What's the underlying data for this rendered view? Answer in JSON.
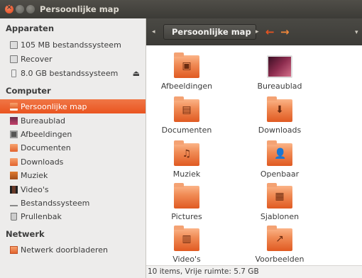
{
  "window": {
    "title": "Persoonlijke map"
  },
  "sidebar": {
    "devices_heading": "Apparaten",
    "devices": [
      {
        "label": "105 MB bestandssysteem",
        "icon": "disk-icon"
      },
      {
        "label": "Recover",
        "icon": "disk-icon"
      },
      {
        "label": "8.0 GB bestandssysteem",
        "icon": "usb-drive-icon",
        "eject": "⏏"
      }
    ],
    "computer_heading": "Computer",
    "computer": [
      {
        "label": "Persoonlijke map",
        "icon": "home-folder-icon",
        "active": true
      },
      {
        "label": "Bureaublad",
        "icon": "desktop-icon"
      },
      {
        "label": "Afbeeldingen",
        "icon": "pictures-folder-icon"
      },
      {
        "label": "Documenten",
        "icon": "documents-folder-icon"
      },
      {
        "label": "Downloads",
        "icon": "downloads-folder-icon"
      },
      {
        "label": "Muziek",
        "icon": "music-folder-icon"
      },
      {
        "label": "Video's",
        "icon": "videos-folder-icon"
      },
      {
        "label": "Bestandssysteem",
        "icon": "filesystem-icon"
      },
      {
        "label": "Prullenbak",
        "icon": "trash-icon"
      }
    ],
    "network_heading": "Netwerk",
    "network": [
      {
        "label": "Netwerk doorbladeren",
        "icon": "network-icon"
      }
    ]
  },
  "toolbar": {
    "breadcrumb": "Persoonlijke map",
    "back_glyph": "←",
    "forward_glyph": "→",
    "left_arrow": "◂",
    "sep_arrow": "▸",
    "menu_arrow": "▾"
  },
  "files": [
    {
      "label": "Afbeeldingen",
      "icon": "pictures-folder-icon",
      "emblem": "▣"
    },
    {
      "label": "Bureaublad",
      "icon": "desktop-icon",
      "emblem": ""
    },
    {
      "label": "Documenten",
      "icon": "documents-folder-icon",
      "emblem": "▤"
    },
    {
      "label": "Downloads",
      "icon": "downloads-folder-icon",
      "emblem": "⬇"
    },
    {
      "label": "Muziek",
      "icon": "music-folder-icon",
      "emblem": "♫"
    },
    {
      "label": "Openbaar",
      "icon": "public-folder-icon",
      "emblem": "👤"
    },
    {
      "label": "Pictures",
      "icon": "folder-icon",
      "emblem": ""
    },
    {
      "label": "Sjablonen",
      "icon": "templates-folder-icon",
      "emblem": "▦"
    },
    {
      "label": "Video's",
      "icon": "videos-folder-icon",
      "emblem": "▥"
    },
    {
      "label": "Voorbeelden",
      "icon": "examples-folder-icon",
      "emblem": "↗"
    }
  ],
  "status": {
    "text": "10 items, Vrije ruimte: 5.7 GB"
  },
  "colors": {
    "accent": "#e95420",
    "titlebar": "#3c3b37",
    "sidebar_bg": "#edeceb"
  }
}
